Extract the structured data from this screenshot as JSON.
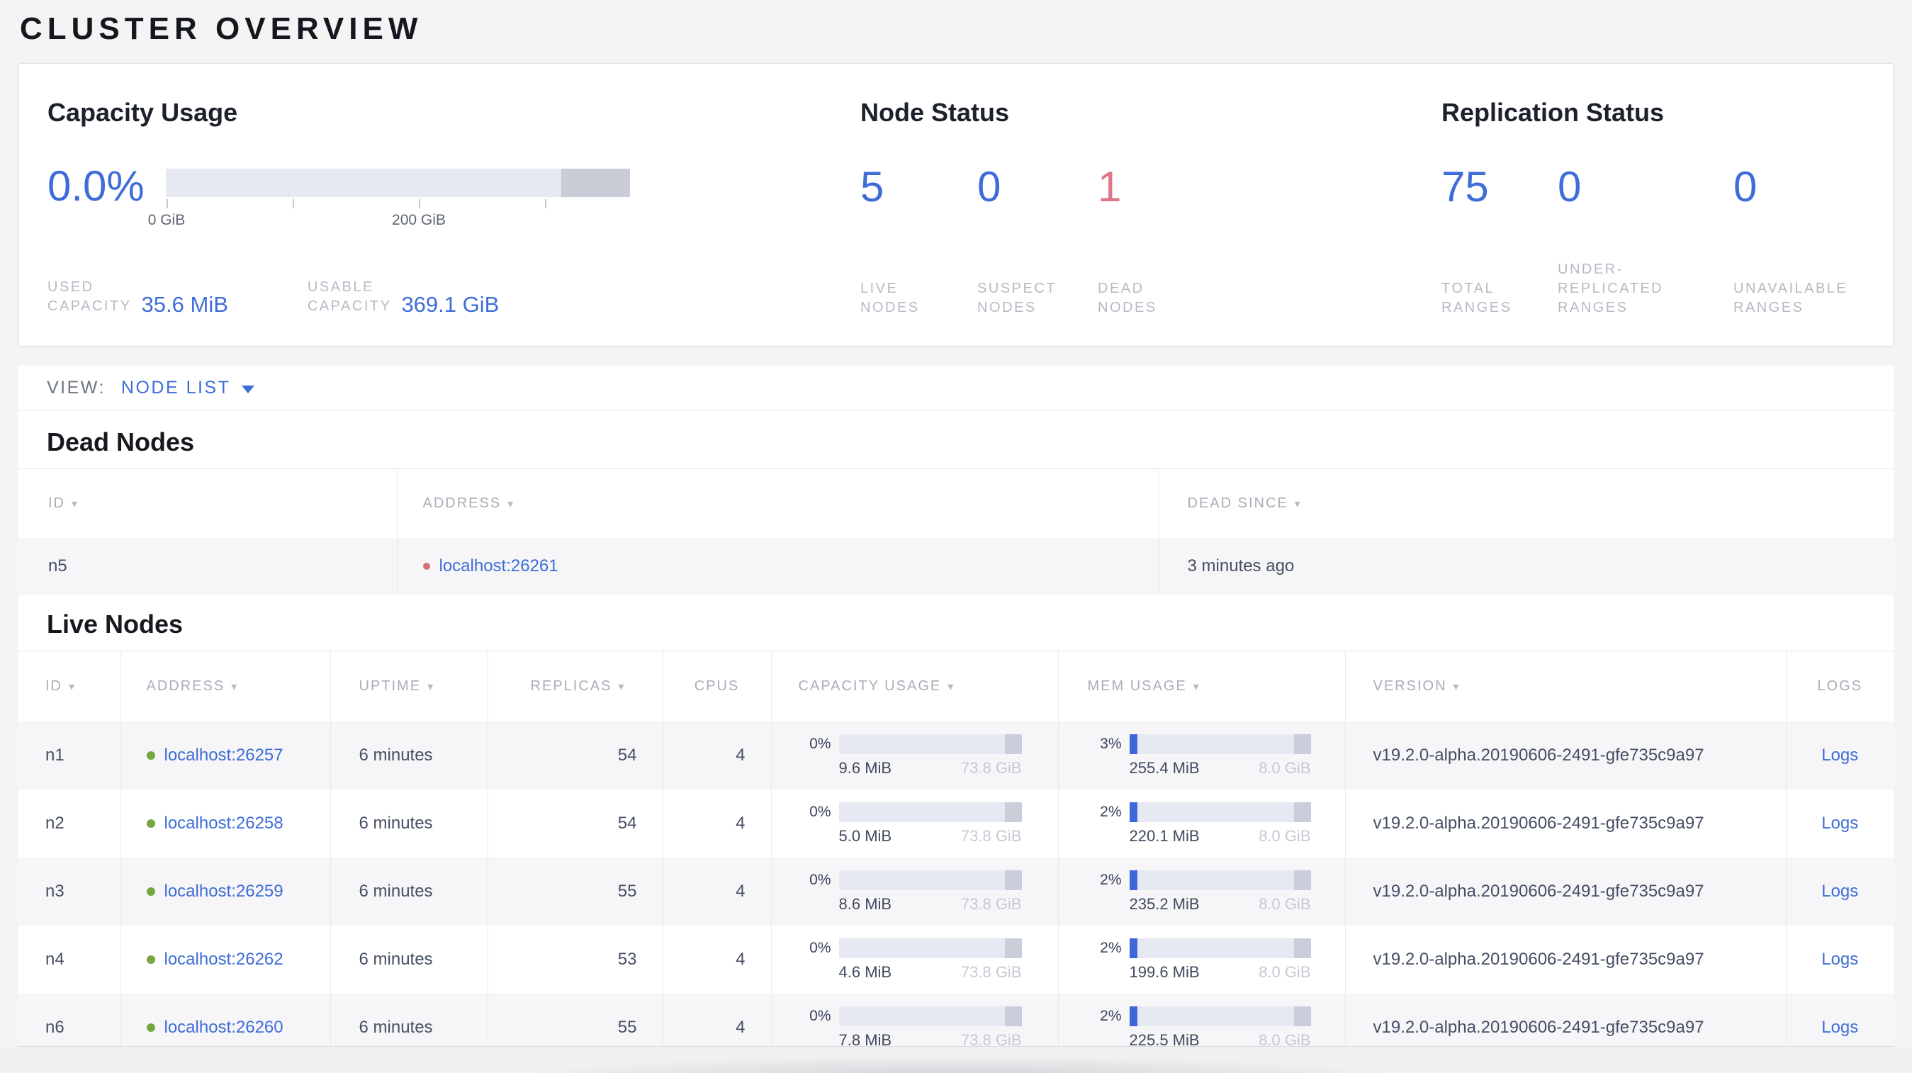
{
  "page": {
    "title": "CLUSTER OVERVIEW"
  },
  "colors": {
    "accent_blue": "#3e6dd8",
    "danger_pink": "#de7589",
    "live_green": "#77a63f",
    "dead_red": "#d27171"
  },
  "overview": {
    "capacity": {
      "title": "Capacity Usage",
      "percent": "0.0%",
      "bar": {
        "tick_labels": [
          "0 GiB",
          "200 GiB"
        ],
        "dark_segment_start_frac": 0.852
      },
      "used_label": "USED\nCAPACITY",
      "used_value": "35.6 MiB",
      "usable_label": "USABLE\nCAPACITY",
      "usable_value": "369.1 GiB"
    },
    "node_status": {
      "title": "Node Status",
      "stats": [
        {
          "value": "5",
          "label": "LIVE\nNODES"
        },
        {
          "value": "0",
          "label": "SUSPECT\nNODES"
        },
        {
          "value": "1",
          "label": "DEAD\nNODES"
        }
      ]
    },
    "replication": {
      "title": "Replication Status",
      "stats": [
        {
          "value": "75",
          "label": "TOTAL\nRANGES"
        },
        {
          "value": "0",
          "label": "UNDER-\nREPLICATED\nRANGES"
        },
        {
          "value": "0",
          "label": "UNAVAILABLE\nRANGES"
        }
      ]
    }
  },
  "view_bar": {
    "label": "VIEW:",
    "selected": "NODE LIST"
  },
  "dead_nodes": {
    "title": "Dead Nodes",
    "columns": [
      {
        "label": "ID",
        "sortable": true
      },
      {
        "label": "ADDRESS",
        "sortable": true
      },
      {
        "label": "DEAD SINCE",
        "sortable": true
      }
    ],
    "rows": [
      {
        "id": "n5",
        "address": "localhost:26261",
        "dead_since": "3 minutes ago"
      }
    ]
  },
  "live_nodes": {
    "title": "Live Nodes",
    "columns": [
      {
        "label": "ID",
        "sortable": true
      },
      {
        "label": "ADDRESS",
        "sortable": true
      },
      {
        "label": "UPTIME",
        "sortable": true
      },
      {
        "label": "REPLICAS",
        "sortable": true
      },
      {
        "label": "CPUS",
        "sortable": false
      },
      {
        "label": "CAPACITY USAGE",
        "sortable": true
      },
      {
        "label": "MEM USAGE",
        "sortable": true
      },
      {
        "label": "VERSION",
        "sortable": true
      },
      {
        "label": "LOGS",
        "sortable": false
      }
    ],
    "rows": [
      {
        "id": "n1",
        "address": "localhost:26257",
        "uptime": "6 minutes",
        "replicas": "54",
        "cpus": "4",
        "capacity": {
          "pct": "0%",
          "used": "9.6 MiB",
          "total": "73.8 GiB",
          "used_frac": 0
        },
        "memory": {
          "pct": "3%",
          "used": "255.4 MiB",
          "total": "8.0 GiB",
          "used_frac": 0.031
        },
        "version": "v19.2.0-alpha.20190606-2491-gfe735c9a97",
        "logs": "Logs"
      },
      {
        "id": "n2",
        "address": "localhost:26258",
        "uptime": "6 minutes",
        "replicas": "54",
        "cpus": "4",
        "capacity": {
          "pct": "0%",
          "used": "5.0 MiB",
          "total": "73.8 GiB",
          "used_frac": 0
        },
        "memory": {
          "pct": "2%",
          "used": "220.1 MiB",
          "total": "8.0 GiB",
          "used_frac": 0.027
        },
        "version": "v19.2.0-alpha.20190606-2491-gfe735c9a97",
        "logs": "Logs"
      },
      {
        "id": "n3",
        "address": "localhost:26259",
        "uptime": "6 minutes",
        "replicas": "55",
        "cpus": "4",
        "capacity": {
          "pct": "0%",
          "used": "8.6 MiB",
          "total": "73.8 GiB",
          "used_frac": 0
        },
        "memory": {
          "pct": "2%",
          "used": "235.2 MiB",
          "total": "8.0 GiB",
          "used_frac": 0.029
        },
        "version": "v19.2.0-alpha.20190606-2491-gfe735c9a97",
        "logs": "Logs"
      },
      {
        "id": "n4",
        "address": "localhost:26262",
        "uptime": "6 minutes",
        "replicas": "53",
        "cpus": "4",
        "capacity": {
          "pct": "0%",
          "used": "4.6 MiB",
          "total": "73.8 GiB",
          "used_frac": 0
        },
        "memory": {
          "pct": "2%",
          "used": "199.6 MiB",
          "total": "8.0 GiB",
          "used_frac": 0.024
        },
        "version": "v19.2.0-alpha.20190606-2491-gfe735c9a97",
        "logs": "Logs"
      },
      {
        "id": "n6",
        "address": "localhost:26260",
        "uptime": "6 minutes",
        "replicas": "55",
        "cpus": "4",
        "capacity": {
          "pct": "0%",
          "used": "7.8 MiB",
          "total": "73.8 GiB",
          "used_frac": 0
        },
        "memory": {
          "pct": "2%",
          "used": "225.5 MiB",
          "total": "8.0 GiB",
          "used_frac": 0.028
        },
        "version": "v19.2.0-alpha.20190606-2491-gfe735c9a97",
        "logs": "Logs"
      }
    ]
  }
}
